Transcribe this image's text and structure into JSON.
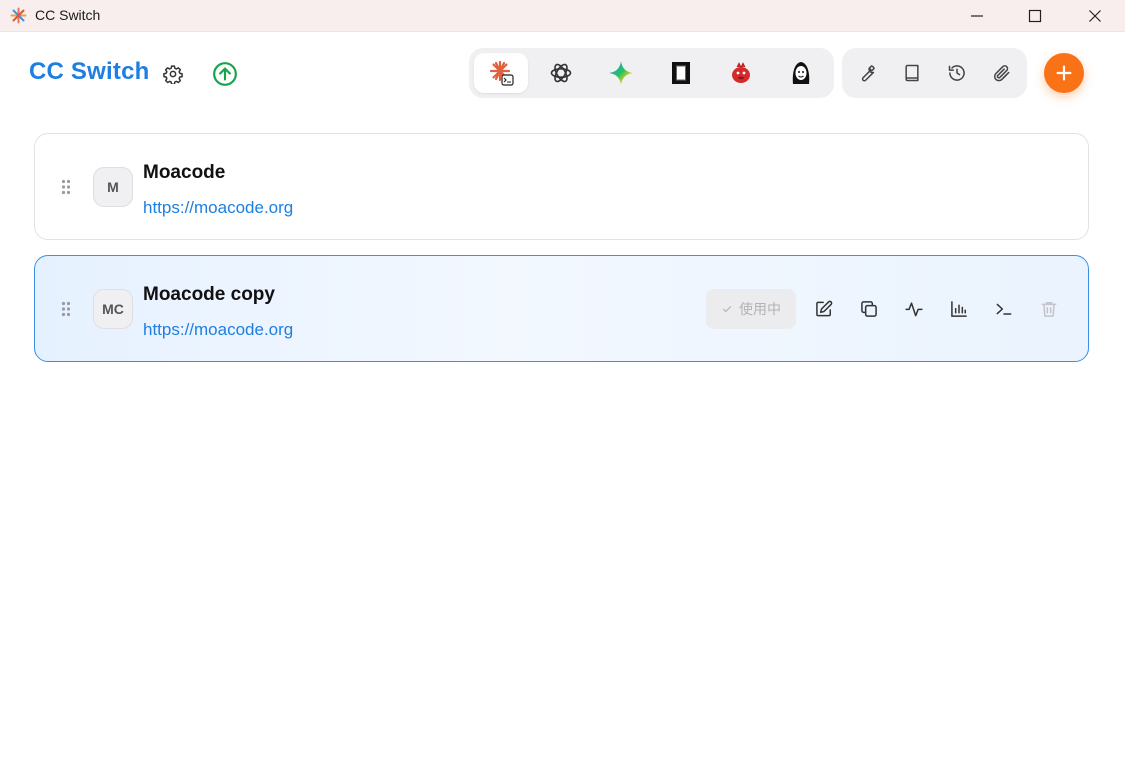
{
  "window": {
    "title": "CC Switch"
  },
  "header": {
    "brand": "CC Switch"
  },
  "app_switcher": {
    "tabs": [
      {
        "name": "claude-code",
        "icon": "claude-code-icon",
        "active": true
      },
      {
        "name": "openai-codex",
        "icon": "openai-icon",
        "active": false
      },
      {
        "name": "gemini",
        "icon": "gemini-icon",
        "active": false
      },
      {
        "name": "app-4",
        "icon": "black-square-icon",
        "active": false
      },
      {
        "name": "app-5",
        "icon": "red-mascot-icon",
        "active": false
      },
      {
        "name": "app-6",
        "icon": "character-icon",
        "active": false
      }
    ]
  },
  "tools": [
    "wrench-icon",
    "book-icon",
    "history-icon",
    "paperclip-icon"
  ],
  "colors": {
    "accent": "#1f7fe0",
    "add": "#f97316",
    "update": "#16a34a"
  },
  "providers": [
    {
      "avatar": "M",
      "name": "Moacode",
      "url": "https://moacode.org",
      "active": false
    },
    {
      "avatar": "MC",
      "name": "Moacode copy",
      "url": "https://moacode.org",
      "active": true,
      "status_label": "使用中"
    }
  ]
}
